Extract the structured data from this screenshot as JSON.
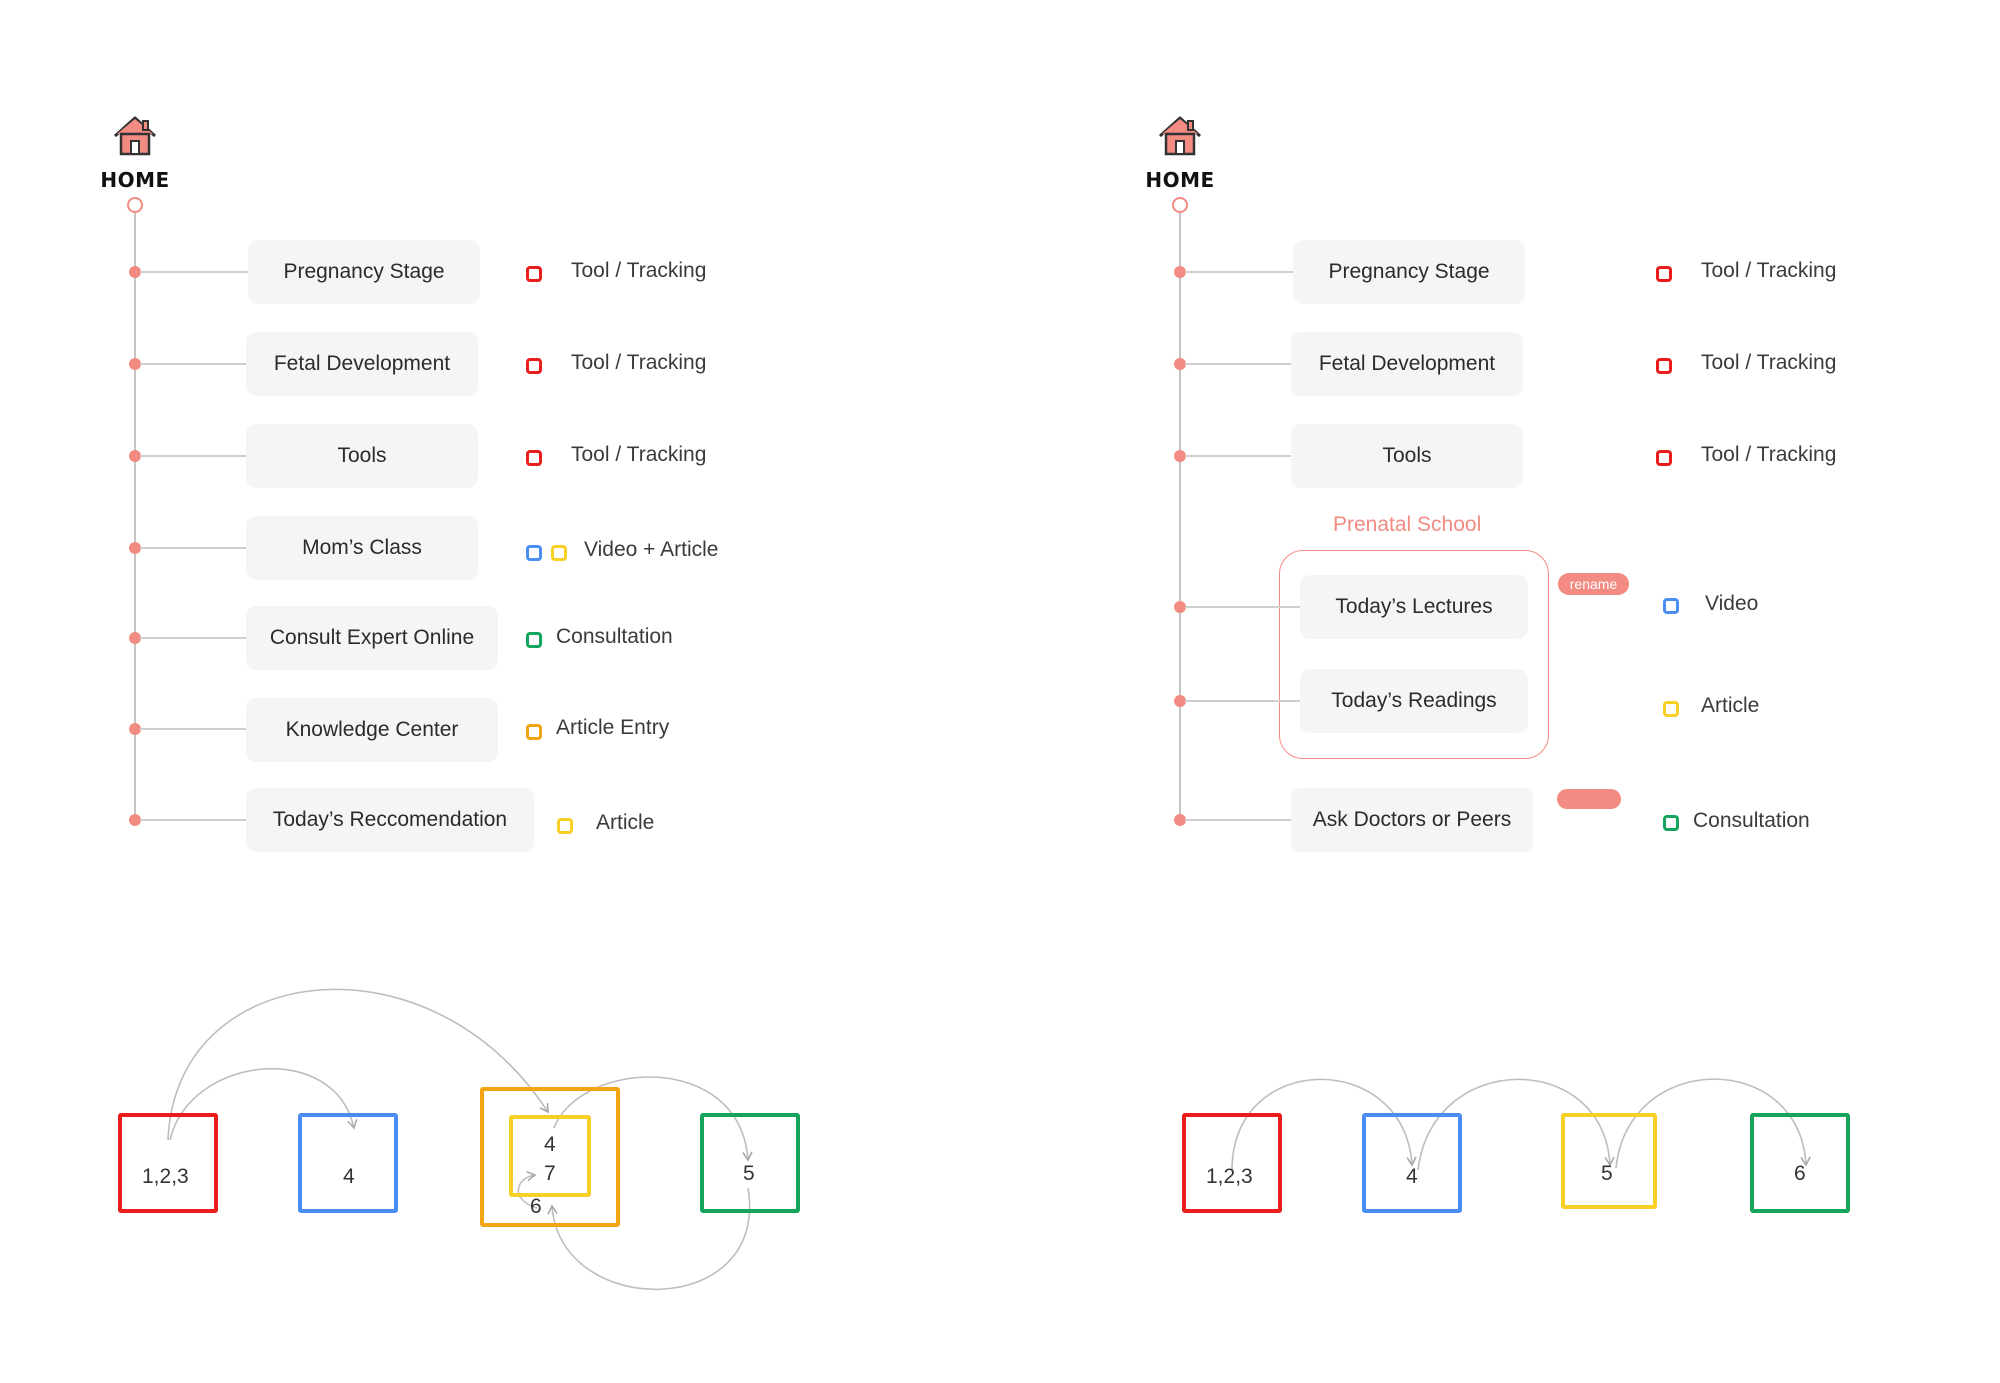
{
  "colors": {
    "accent": "#f28b82",
    "red": "#ea1c1c",
    "blue": "#4a8ef5",
    "yellow": "#f8cf24",
    "orange": "#f2a413",
    "green": "#14a45c",
    "pill_bg": "#f4f5f7",
    "connector": "#c4c4c4"
  },
  "left_map": {
    "home_label": "HOME",
    "home_icon": "house-icon",
    "items": [
      {
        "label": "Pregnancy Stage",
        "tags": [
          "red"
        ],
        "tag_text": "Tool / Tracking"
      },
      {
        "label": "Fetal Development",
        "tags": [
          "red"
        ],
        "tag_text": "Tool / Tracking"
      },
      {
        "label": "Tools",
        "tags": [
          "red"
        ],
        "tag_text": "Tool / Tracking"
      },
      {
        "label": "Mom’s Class",
        "tags": [
          "blue",
          "yellow"
        ],
        "tag_text": "Video + Article"
      },
      {
        "label": "Consult Expert Online",
        "tags": [
          "green"
        ],
        "tag_text": "Consultation"
      },
      {
        "label": "Knowledge Center",
        "tags": [
          "orange"
        ],
        "tag_text": "Article Entry"
      },
      {
        "label": "Today’s Reccomendation",
        "tags": [
          "yellow"
        ],
        "tag_text": "Article"
      }
    ]
  },
  "right_map": {
    "home_label": "HOME",
    "home_icon": "house-icon",
    "group_title": "Prenatal School",
    "rename_badge": "rename",
    "items": [
      {
        "label": "Pregnancy Stage",
        "tags": [
          "red"
        ],
        "tag_text": "Tool / Tracking"
      },
      {
        "label": "Fetal Development",
        "tags": [
          "red"
        ],
        "tag_text": "Tool / Tracking"
      },
      {
        "label": "Tools",
        "tags": [
          "red"
        ],
        "tag_text": "Tool / Tracking"
      },
      {
        "label": "Today’s Lectures",
        "tags": [
          "blue"
        ],
        "tag_text": "Video"
      },
      {
        "label": "Today’s Readings",
        "tags": [
          "yellow"
        ],
        "tag_text": "Article"
      },
      {
        "label": "Ask Doctors or Peers",
        "tags": [
          "green"
        ],
        "tag_text": "Consultation"
      }
    ]
  },
  "left_flow": {
    "boxes": [
      {
        "color": "red",
        "label": "1,2,3"
      },
      {
        "color": "blue",
        "label": "4"
      },
      {
        "color": "orange",
        "labels": [
          "4",
          "7",
          "6"
        ],
        "inner_color": "yellow"
      },
      {
        "color": "green",
        "label": "5"
      }
    ]
  },
  "right_flow": {
    "boxes": [
      {
        "color": "red",
        "label": "1,2,3"
      },
      {
        "color": "blue",
        "label": "4"
      },
      {
        "color": "yellow",
        "label": "5"
      },
      {
        "color": "green",
        "label": "6"
      }
    ]
  }
}
